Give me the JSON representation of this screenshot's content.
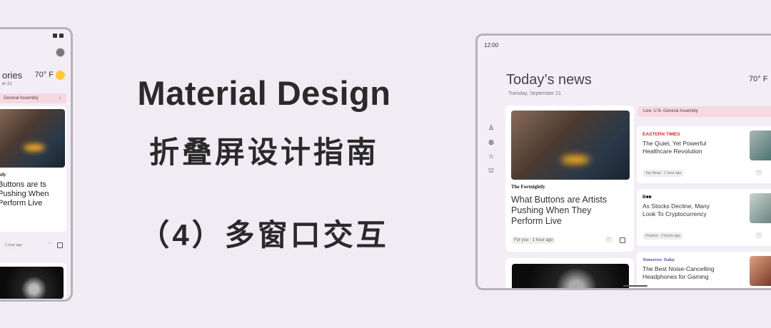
{
  "title": "Material Design",
  "subtitle": "折叠屏设计指南",
  "part": "（4）多窗口交互",
  "phone": {
    "title": "ories",
    "date": "er 21",
    "temperature": "70° F",
    "banner": "General Assembly",
    "banner_chevron": "›",
    "publisher": "htly",
    "headline": "Buttons are ts Pushing When Perform Live",
    "chip": "1 hour ago",
    "more": "···",
    "nav": [
      "◍",
      "☆",
      "⛫"
    ]
  },
  "tablet": {
    "time": "12:00",
    "title": "Today’s news",
    "date": "Tuesday, September 21",
    "temperature": "70° F",
    "rail_icons": [
      "♙",
      "◍",
      "☆",
      "⛫"
    ],
    "main_card": {
      "publisher": "The Fortnightly",
      "headline": "What Buttons are Artists Pushing When They Perform Live",
      "chip": "For you · 1 hour ago",
      "more": "···"
    },
    "banner": "Live: U.N. General Assembly",
    "cards": [
      {
        "publisher": "EASTERN TIMES",
        "headline": "The Quiet, Yet Powerful Healthcare Revolution",
        "chip": "Top News · 1 hour ago",
        "more": "···",
        "thumb_color": "#6e8c8a",
        "pub_color": "#d32f2f"
      },
      {
        "publisher": "B■■",
        "headline": "As Stocks Decline, Many Look To Cryptocurrency",
        "chip": "Finance · 2 hours ago",
        "more": "···",
        "thumb_color": "#7a8f8a",
        "pub_color": "#111111"
      },
      {
        "publisher": "Tomorrow Today",
        "headline": "The Best Noise-Cancelling Headphones for Gaming",
        "chip": "",
        "more": "",
        "thumb_color": "#a5553a",
        "pub_color": "#5b3fa8"
      }
    ]
  },
  "colors": {
    "background": "#f1ecf3",
    "banner": "#f7d9e0",
    "sun": "#ffc93a"
  }
}
